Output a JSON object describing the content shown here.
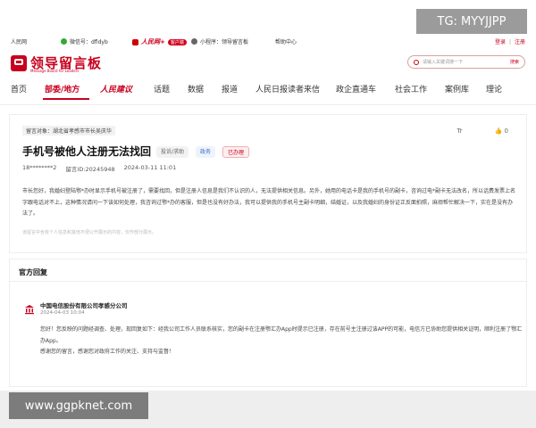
{
  "topbar": {
    "site": "人民网",
    "wechat": "微信号：dfldyb",
    "app_logo": "人民网+",
    "app_badge": "客户端",
    "miniprogram": "小程序：领导留言板",
    "help": "帮助中心",
    "login": "登录",
    "separator": "|",
    "register": "注册"
  },
  "logo": {
    "title": "领导留言板",
    "subtitle": "Message Board for Leaders"
  },
  "search": {
    "placeholder": "请输入关键词搜一下",
    "button": "搜索"
  },
  "nav": {
    "items": [
      "首页",
      "部委/地方",
      "人民建议",
      "话题",
      "数据",
      "报道",
      "人民日报读者来信",
      "政企直通车",
      "社会工作",
      "案例库",
      "理论"
    ],
    "active": "部委/地方"
  },
  "message": {
    "target": "留言对象：湖北省孝感市市长吴庆华",
    "font_tool": "Tr",
    "like_count": "0",
    "title": "手机号被他人注册无法找回",
    "tags": [
      "投诉/求助",
      "政务",
      "已办理"
    ],
    "user": "18********2",
    "message_id": "留言ID:20245948",
    "time": "2024-03-11 11:01",
    "body": "市长您好，我婚妇登陆鄂*办时显示手机号被注册了，需要找回，但是注册人信息是我们不认识的人，无法提供相关信息。另外，她用的电话卡是我的手机号的副卡，咨询过电*副卡无法改名，所以话费发票上名字跟电话对不上，这种情况请问一下该如何处理，我咨询过鄂*办的客服，但是也没有好办法，我可以提供我的手机号主副卡明细，结婚证，以及我婚妇的身份证正反面拍照，麻烦帮忙解决一下，实在是没有办法了。",
    "tip": "该留言中含有个人信息和其他不便公开展示的内容，仅作部分展示。"
  },
  "reply": {
    "heading": "官方回复",
    "org": "中国电信股份有限公司孝感分公司",
    "date": "2024-04-03 10:04",
    "body_1": "您好！您反映的问题经调查、处理，现回复如下：经我公司工作人员联系核实，您的副卡在注册鄂汇办App时提示已注册，存在前号主注册过该APP的可能，电信方已协助您提供相关证明，顺利注册了鄂汇办App。",
    "body_2": "感谢您的留言，感谢您对政府工作的关注、支持与监督！"
  },
  "overlays": {
    "tg": "TG: MYYJJPP",
    "watermark": "www.ggpknet.com"
  },
  "colors": {
    "accent": "#c8001e"
  }
}
